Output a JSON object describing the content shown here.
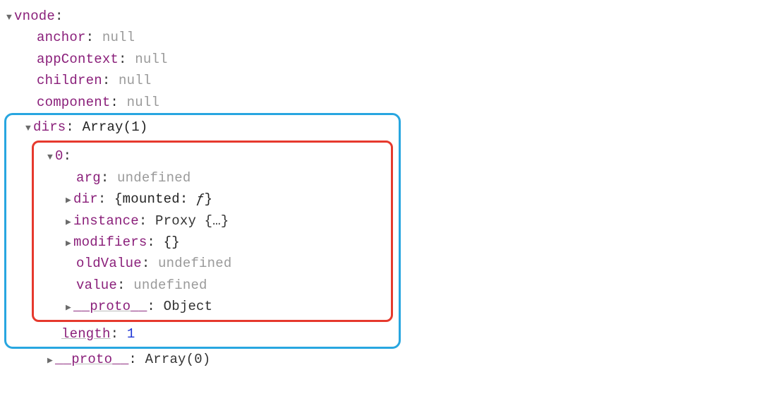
{
  "root": {
    "name": "vnode",
    "props": [
      {
        "key": "anchor",
        "val": "null",
        "cls": "val-null"
      },
      {
        "key": "appContext",
        "val": "null",
        "cls": "val-null"
      },
      {
        "key": "children",
        "val": "null",
        "cls": "val-null"
      },
      {
        "key": "component",
        "val": "null",
        "cls": "val-null"
      }
    ],
    "dirs": {
      "key": "dirs",
      "summary": "Array(1)",
      "item0": {
        "label": "0",
        "entries": [
          {
            "key": "arg",
            "val": "undefined",
            "cls": "val-undef",
            "tri": "none"
          },
          {
            "key": "dir",
            "open": "{mounted: ",
            "fn": "ƒ",
            "close": "}",
            "tri": "right"
          },
          {
            "key": "instance",
            "val": "Proxy {…}",
            "cls": "val-text",
            "tri": "right"
          },
          {
            "key": "modifiers",
            "val": "{}",
            "cls": "val-text-dark",
            "tri": "right"
          },
          {
            "key": "oldValue",
            "val": "undefined",
            "cls": "val-undef",
            "tri": "none"
          },
          {
            "key": "value",
            "val": "undefined",
            "cls": "val-undef",
            "tri": "none"
          },
          {
            "key": "__proto__",
            "val": "Object",
            "cls": "val-text",
            "tri": "right",
            "proto": true
          }
        ]
      },
      "length": {
        "key": "length",
        "val": "1"
      },
      "proto": {
        "key": "__proto__",
        "val": "Array(0)"
      }
    }
  }
}
